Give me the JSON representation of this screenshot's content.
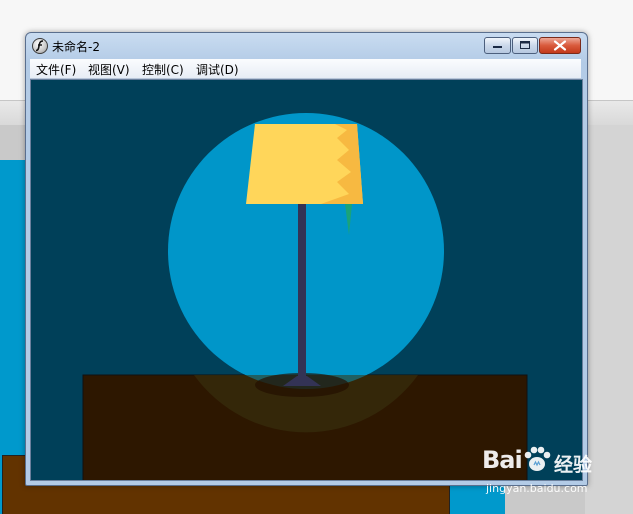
{
  "window": {
    "title": "未命名-2",
    "controls": [
      "minimize",
      "maximize",
      "close"
    ]
  },
  "menu": {
    "file": "文件(F)",
    "view": "视图(V)",
    "control": "控制(C)",
    "debug": "调试(D)"
  },
  "scene": {
    "description_colors": {
      "background": "#004059",
      "spotlight_circle": "#0099cc",
      "lampshade": "#ffd65a",
      "lampshade_highlight": "#f7b941",
      "lamp_pole": "#333355",
      "table": "#2d1700",
      "drip": "#1aa37a"
    }
  },
  "background_app": {
    "colors": {
      "blue_stage": "#0099cc",
      "brown_table": "#623300",
      "gray_panel": "#c9c9c9"
    }
  },
  "watermark": {
    "logo_text": "Bai",
    "logo_suffix": "经验",
    "url": "jingyan.baidu.com"
  }
}
